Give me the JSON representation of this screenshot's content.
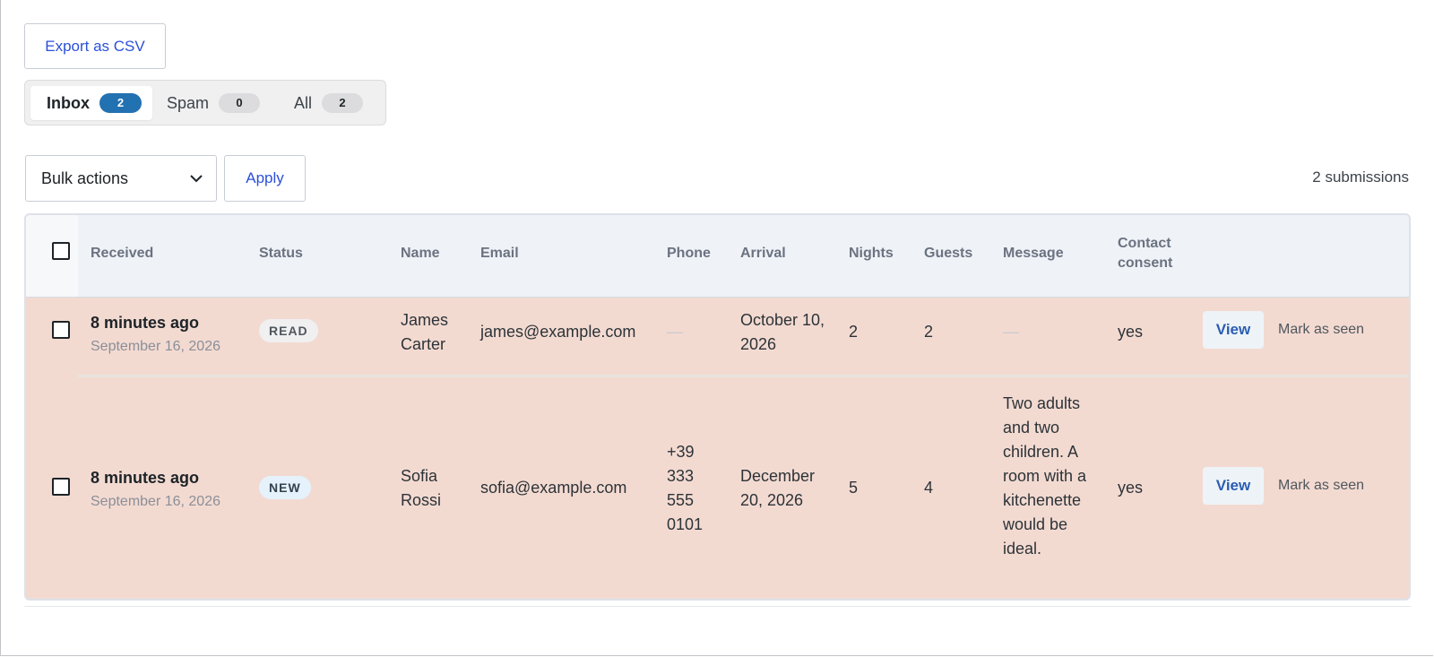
{
  "toolbar": {
    "export_label": "Export as CSV",
    "bulk_actions_label": "Bulk actions",
    "apply_label": "Apply",
    "submission_count": "2 submissions"
  },
  "tabs": [
    {
      "label": "Inbox",
      "count": "2",
      "active": true
    },
    {
      "label": "Spam",
      "count": "0",
      "active": false
    },
    {
      "label": "All",
      "count": "2",
      "active": false
    }
  ],
  "table": {
    "columns": [
      "Received",
      "Status",
      "Name",
      "Email",
      "Phone",
      "Arrival",
      "Nights",
      "Guests",
      "Message",
      "Contact consent"
    ],
    "rows": [
      {
        "received_relative": "8 minutes ago",
        "received_date": "September 16, 2026",
        "status": "READ",
        "name": "James Carter",
        "email": "james@example.com",
        "phone": "—",
        "arrival": "October 10, 2026",
        "nights": "2",
        "guests": "2",
        "message": "—",
        "consent": "yes",
        "view_label": "View",
        "mark_label": "Mark as seen"
      },
      {
        "received_relative": "8 minutes ago",
        "received_date": "September 16, 2026",
        "status": "NEW",
        "name": "Sofia Rossi",
        "email": "sofia@example.com",
        "phone": "+39 333 555 0101",
        "arrival": "December 20, 2026",
        "nights": "5",
        "guests": "4",
        "message": "Two adults and two children. A room with a kitchenette would be ideal.",
        "consent": "yes",
        "view_label": "View",
        "mark_label": "Mark as seen"
      }
    ]
  },
  "colors": {
    "accent": "#2271b1",
    "link": "#2b50d8",
    "row_highlight": "#f3dad1",
    "header_bg": "#eff2f7"
  }
}
